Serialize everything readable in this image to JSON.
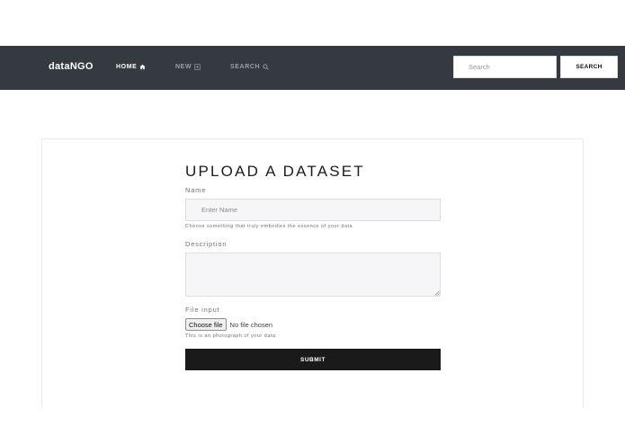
{
  "navbar": {
    "brand": "dataNGO",
    "links": [
      {
        "label": "HOME",
        "icon": "home-icon",
        "active": true
      },
      {
        "label": "NEW",
        "icon": "plus-square-icon",
        "active": false
      },
      {
        "label": "SEARCH",
        "icon": "search-icon",
        "active": false
      }
    ],
    "search": {
      "placeholder": "Search",
      "button_label": "SEARCH"
    }
  },
  "form": {
    "title": "UPLOAD A DATASET",
    "name": {
      "label": "Name",
      "placeholder": "Enter Name",
      "help": "Choose something that truly embodies the essence of your data"
    },
    "description": {
      "label": "Description",
      "value": ""
    },
    "file": {
      "label": "File input",
      "button_label": "Choose file",
      "status": "No file chosen",
      "help": "This is an photograph of your data"
    },
    "submit_label": "SUBMIT"
  },
  "colors": {
    "navbar_bg": "#343a40",
    "submit_bg": "#1a1a1a",
    "input_bg": "#f6f6f8"
  }
}
